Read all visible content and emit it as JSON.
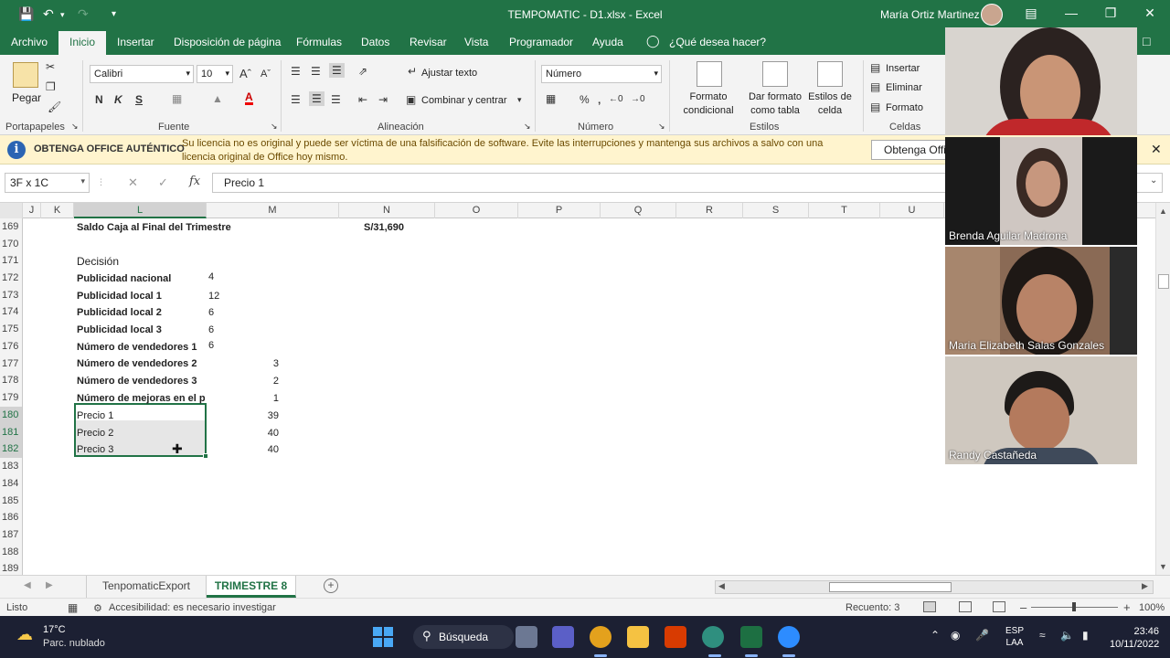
{
  "titlebar": {
    "title": "TEMPOMATIC - D1.xlsx  -  Excel",
    "user": "María Ortiz Martinez"
  },
  "menu": {
    "tabs": [
      "Archivo",
      "Inicio",
      "Insertar",
      "Disposición de página",
      "Fórmulas",
      "Datos",
      "Revisar",
      "Vista",
      "Programador",
      "Ayuda"
    ],
    "active": "Inicio",
    "tell_me": "¿Qué desea hacer?"
  },
  "ribbon": {
    "clipboard": {
      "paste": "Pegar",
      "label": "Portapapeles"
    },
    "font": {
      "name": "Calibri",
      "size": "10",
      "bold": "N",
      "italic": "K",
      "underline": "S",
      "label": "Fuente"
    },
    "alignment": {
      "wrap": "Ajustar texto",
      "merge": "Combinar y centrar",
      "label": "Alineación"
    },
    "number": {
      "format": "Número",
      "label": "Número"
    },
    "styles": {
      "conditional": "Formato condicional",
      "table": "Dar formato como tabla",
      "cell": "Estilos de celda",
      "label": "Estilos"
    },
    "cells": {
      "insert": "Insertar",
      "delete": "Eliminar",
      "format": "Formato",
      "label": "Celdas"
    }
  },
  "notify": {
    "title": "OBTENGA OFFICE AUTÉNTICO",
    "message": "Su licencia no es original y puede ser víctima de una falsificación de software. Evite las interrupciones y mantenga sus archivos a salvo con una licencia original de Office hoy mismo.",
    "button": "Obtenga Office"
  },
  "formulabar": {
    "namebox": "3F x 1C",
    "formula": "Precio 1"
  },
  "grid": {
    "columns": [
      "J",
      "K",
      "L",
      "M",
      "N",
      "O",
      "P",
      "Q",
      "R",
      "S",
      "T",
      "U"
    ],
    "rows": [
      "169",
      "170",
      "171",
      "172",
      "173",
      "174",
      "175",
      "176",
      "177",
      "178",
      "179",
      "180",
      "181",
      "182",
      "183",
      "184",
      "185",
      "186",
      "187",
      "188",
      "189"
    ],
    "cells": {
      "r169_label": "Saldo Caja al Final del Trimestre",
      "r169_value": "S/31,690",
      "r171_label": "Decisión",
      "r172_label": "Publicidad nacional",
      "r172_value": "4",
      "r173_label": "Publicidad local 1",
      "r173_value": "12",
      "r174_label": "Publicidad local 2",
      "r174_value": "6",
      "r175_label": "Publicidad local 3",
      "r175_value": "6",
      "r176_label": "Número de vendedores 1",
      "r176_value": "6",
      "r177_label": "Número de vendedores 2",
      "r177_value": "3",
      "r178_label": "Número de vendedores 3",
      "r178_value": "2",
      "r179_label": "Número de mejoras en el p",
      "r179_value": "1",
      "r180_label": "Precio 1",
      "r180_value": "39",
      "r181_label": "Precio 2",
      "r181_value": "40",
      "r182_label": "Precio 3",
      "r182_value": "40"
    }
  },
  "sheets": {
    "tabs": [
      "TenpomaticExport",
      "TRIMESTRE 8"
    ],
    "active": "TRIMESTRE 8"
  },
  "status": {
    "mode": "Listo",
    "accessibility": "Accesibilidad: es necesario investigar",
    "count": "Recuento: 3",
    "zoom": "100%"
  },
  "taskbar": {
    "temperature": "17°C",
    "condition": "Parc. nublado",
    "search": "Búsqueda",
    "lang_1": "ESP",
    "lang_2": "LAA",
    "time": "23:46",
    "date": "10/11/2022"
  },
  "participants": [
    "Brenda Aguilar Madrona",
    "Maria Elizabeth Salas Gonzales",
    "Randy Castañeda"
  ],
  "colors": {
    "excel_green": "#217346",
    "notify_bg": "#fff4ce",
    "taskbar": "#1c2033"
  }
}
